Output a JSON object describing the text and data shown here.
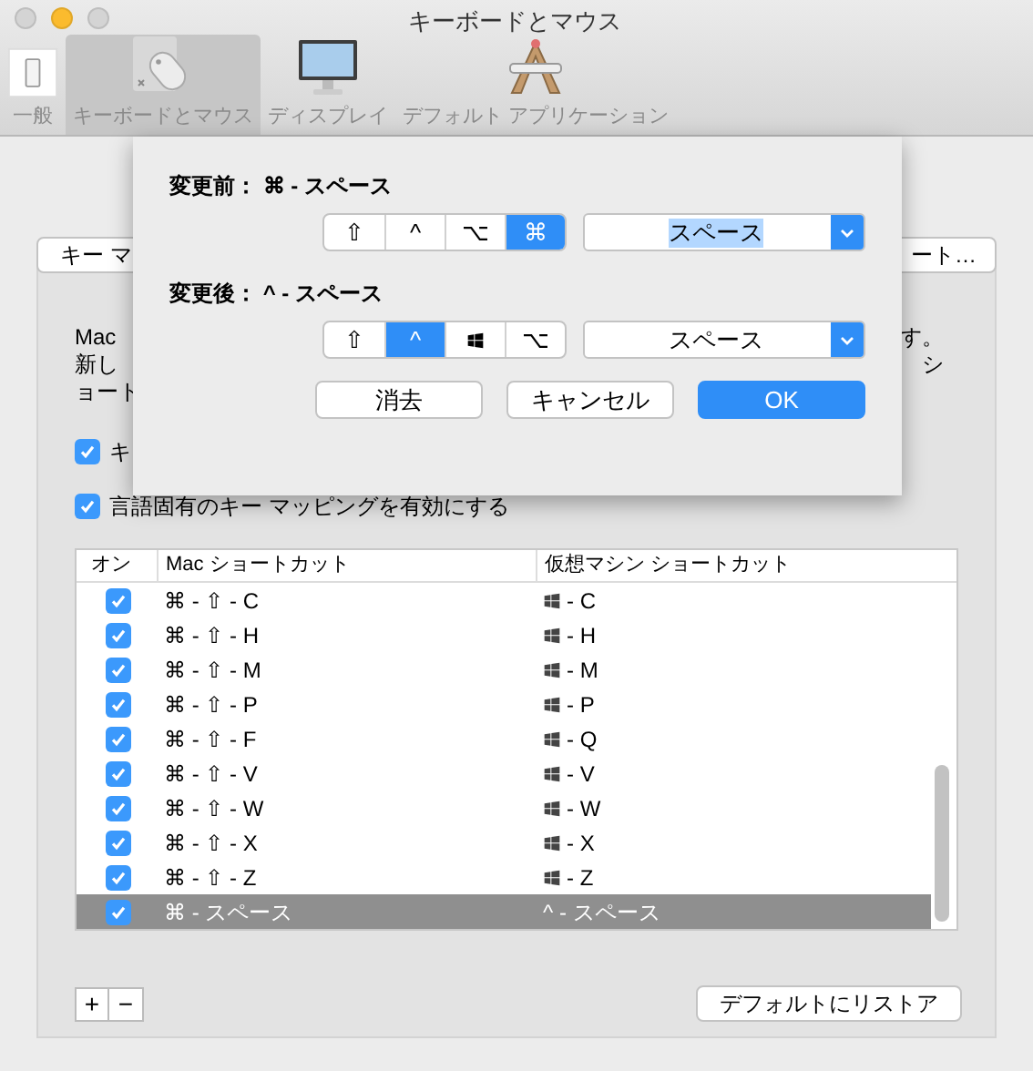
{
  "window": {
    "title": "キーボードとマウス",
    "lights": [
      {
        "color": "#d4d4d4"
      },
      {
        "color": "#fbbb2e"
      },
      {
        "color": "#d4d4d4"
      }
    ]
  },
  "toolbar": [
    {
      "kind": "switch",
      "label": "一般",
      "selected": false
    },
    {
      "kind": "keyboard",
      "label": "キーボードとマウス",
      "selected": true
    },
    {
      "kind": "display",
      "label": "ディスプレイ",
      "selected": false
    },
    {
      "kind": "apps",
      "label": "デフォルト アプリケーション",
      "selected": false
    }
  ],
  "panel": {
    "tab_left": "キー マ",
    "tab_right": "ート…",
    "text_left": [
      "Mac",
      "新し",
      "ョート"
    ],
    "text_right": [
      "す。",
      "シ"
    ],
    "checkboxes": [
      {
        "label": "キ",
        "checked": true
      },
      {
        "label": "言語固有のキー マッピングを有効にする",
        "checked": true
      }
    ]
  },
  "table": {
    "columns": [
      "オン",
      "Mac ショートカット",
      "仮想マシン ショートカット"
    ],
    "rows": [
      {
        "on": true,
        "mac": "⌘ - ⇧ - C",
        "vm_win": true,
        "vm": "- C",
        "selected": false
      },
      {
        "on": true,
        "mac": "⌘ - ⇧ - H",
        "vm_win": true,
        "vm": "- H",
        "selected": false
      },
      {
        "on": true,
        "mac": "⌘ - ⇧ - M",
        "vm_win": true,
        "vm": "- M",
        "selected": false
      },
      {
        "on": true,
        "mac": "⌘ - ⇧ - P",
        "vm_win": true,
        "vm": "- P",
        "selected": false
      },
      {
        "on": true,
        "mac": "⌘ - ⇧ - F",
        "vm_win": true,
        "vm": "- Q",
        "selected": false
      },
      {
        "on": true,
        "mac": "⌘ - ⇧ - V",
        "vm_win": true,
        "vm": "- V",
        "selected": false
      },
      {
        "on": true,
        "mac": "⌘ - ⇧ - W",
        "vm_win": true,
        "vm": "- W",
        "selected": false
      },
      {
        "on": true,
        "mac": "⌘ - ⇧ - X",
        "vm_win": true,
        "vm": "- X",
        "selected": false
      },
      {
        "on": true,
        "mac": "⌘ - ⇧ - Z",
        "vm_win": true,
        "vm": "- Z",
        "selected": false
      },
      {
        "on": true,
        "mac": "⌘ - スペース",
        "vm_win": false,
        "vm": "^ - スペース",
        "selected": true
      }
    ]
  },
  "bottom": {
    "add": "+",
    "remove": "−",
    "restore": "デフォルトにリストア"
  },
  "sheet": {
    "sections": [
      {
        "heading": "変更前： ⌘ - スペース",
        "keys": [
          {
            "kind": "glyph",
            "label": "⇧",
            "selected": false
          },
          {
            "kind": "glyph",
            "label": "^",
            "selected": false
          },
          {
            "kind": "glyph",
            "label": "⌥",
            "selected": false
          },
          {
            "kind": "glyph",
            "label": "⌘",
            "selected": true
          }
        ],
        "key_value": "スペース",
        "highlighted": true
      },
      {
        "heading": "変更後： ^ - スペース",
        "keys": [
          {
            "kind": "glyph",
            "label": "⇧",
            "selected": false
          },
          {
            "kind": "glyph",
            "label": "^",
            "selected": true
          },
          {
            "kind": "windows",
            "selected": false
          },
          {
            "kind": "glyph",
            "label": "⌥",
            "selected": false
          }
        ],
        "key_value": "スペース",
        "highlighted": false
      }
    ],
    "buttons": [
      {
        "label": "消去",
        "default": false
      },
      {
        "label": "キャンセル",
        "default": false
      },
      {
        "label": "OK",
        "default": true
      }
    ]
  }
}
